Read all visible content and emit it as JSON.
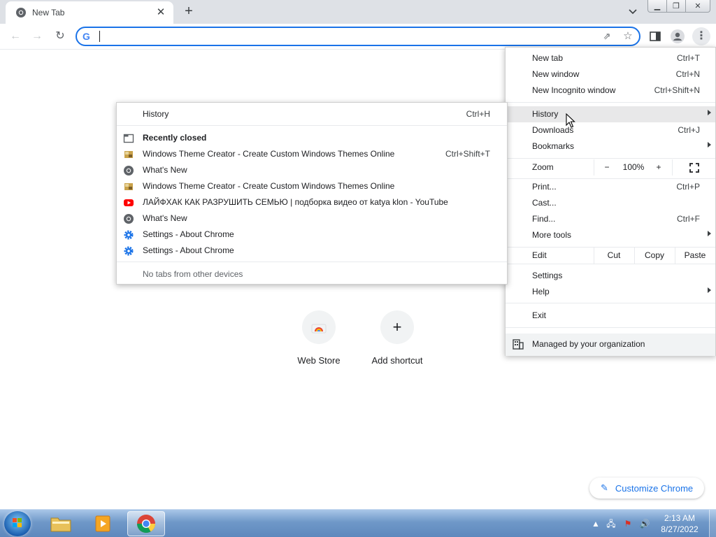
{
  "tab": {
    "title": "New Tab"
  },
  "omnibox": {
    "value": "",
    "placeholder": ""
  },
  "shortcuts": [
    {
      "label": "Web Store"
    },
    {
      "label": "Add shortcut"
    }
  ],
  "customize": {
    "label": "Customize Chrome"
  },
  "chrome_menu": {
    "new_tab": {
      "label": "New tab",
      "shortcut": "Ctrl+T"
    },
    "new_window": {
      "label": "New window",
      "shortcut": "Ctrl+N"
    },
    "new_incognito": {
      "label": "New Incognito window",
      "shortcut": "Ctrl+Shift+N"
    },
    "history": {
      "label": "History"
    },
    "downloads": {
      "label": "Downloads",
      "shortcut": "Ctrl+J"
    },
    "bookmarks": {
      "label": "Bookmarks"
    },
    "zoom": {
      "label": "Zoom",
      "minus": "−",
      "value": "100%",
      "plus": "+"
    },
    "print": {
      "label": "Print...",
      "shortcut": "Ctrl+P"
    },
    "cast": {
      "label": "Cast..."
    },
    "find": {
      "label": "Find...",
      "shortcut": "Ctrl+F"
    },
    "more_tools": {
      "label": "More tools"
    },
    "edit": {
      "label": "Edit",
      "cut": "Cut",
      "copy": "Copy",
      "paste": "Paste"
    },
    "settings": {
      "label": "Settings"
    },
    "help": {
      "label": "Help"
    },
    "exit": {
      "label": "Exit"
    },
    "managed": {
      "label": "Managed by your organization"
    }
  },
  "history_submenu": {
    "history": {
      "label": "History",
      "shortcut": "Ctrl+H"
    },
    "recently_closed": {
      "label": "Recently closed"
    },
    "items": [
      {
        "label": "Windows Theme Creator - Create Custom Windows Themes Online",
        "shortcut": "Ctrl+Shift+T",
        "icon": "theme-creator-icon"
      },
      {
        "label": "What's New",
        "shortcut": "",
        "icon": "chrome-icon"
      },
      {
        "label": "Windows Theme Creator - Create Custom Windows Themes Online",
        "shortcut": "",
        "icon": "theme-creator-icon"
      },
      {
        "label": "ЛАЙФХАК КАК РАЗРУШИТЬ СЕМЬЮ | подборка видео от katya klon - YouTube",
        "shortcut": "",
        "icon": "youtube-icon"
      },
      {
        "label": "What's New",
        "shortcut": "",
        "icon": "chrome-icon"
      },
      {
        "label": "Settings - About Chrome",
        "shortcut": "",
        "icon": "settings-icon"
      },
      {
        "label": "Settings - About Chrome",
        "shortcut": "",
        "icon": "settings-icon"
      }
    ],
    "no_tabs": {
      "label": "No tabs from other devices"
    }
  },
  "taskbar": {
    "clock_time": "2:13 AM",
    "clock_date": "8/27/2022"
  },
  "colors": {
    "accent": "#1a73e8",
    "tabstrip": "#dee1e6",
    "menu_highlight": "#e8e8e9",
    "youtube": "#ff0000",
    "settings_blue": "#1a73e8"
  }
}
